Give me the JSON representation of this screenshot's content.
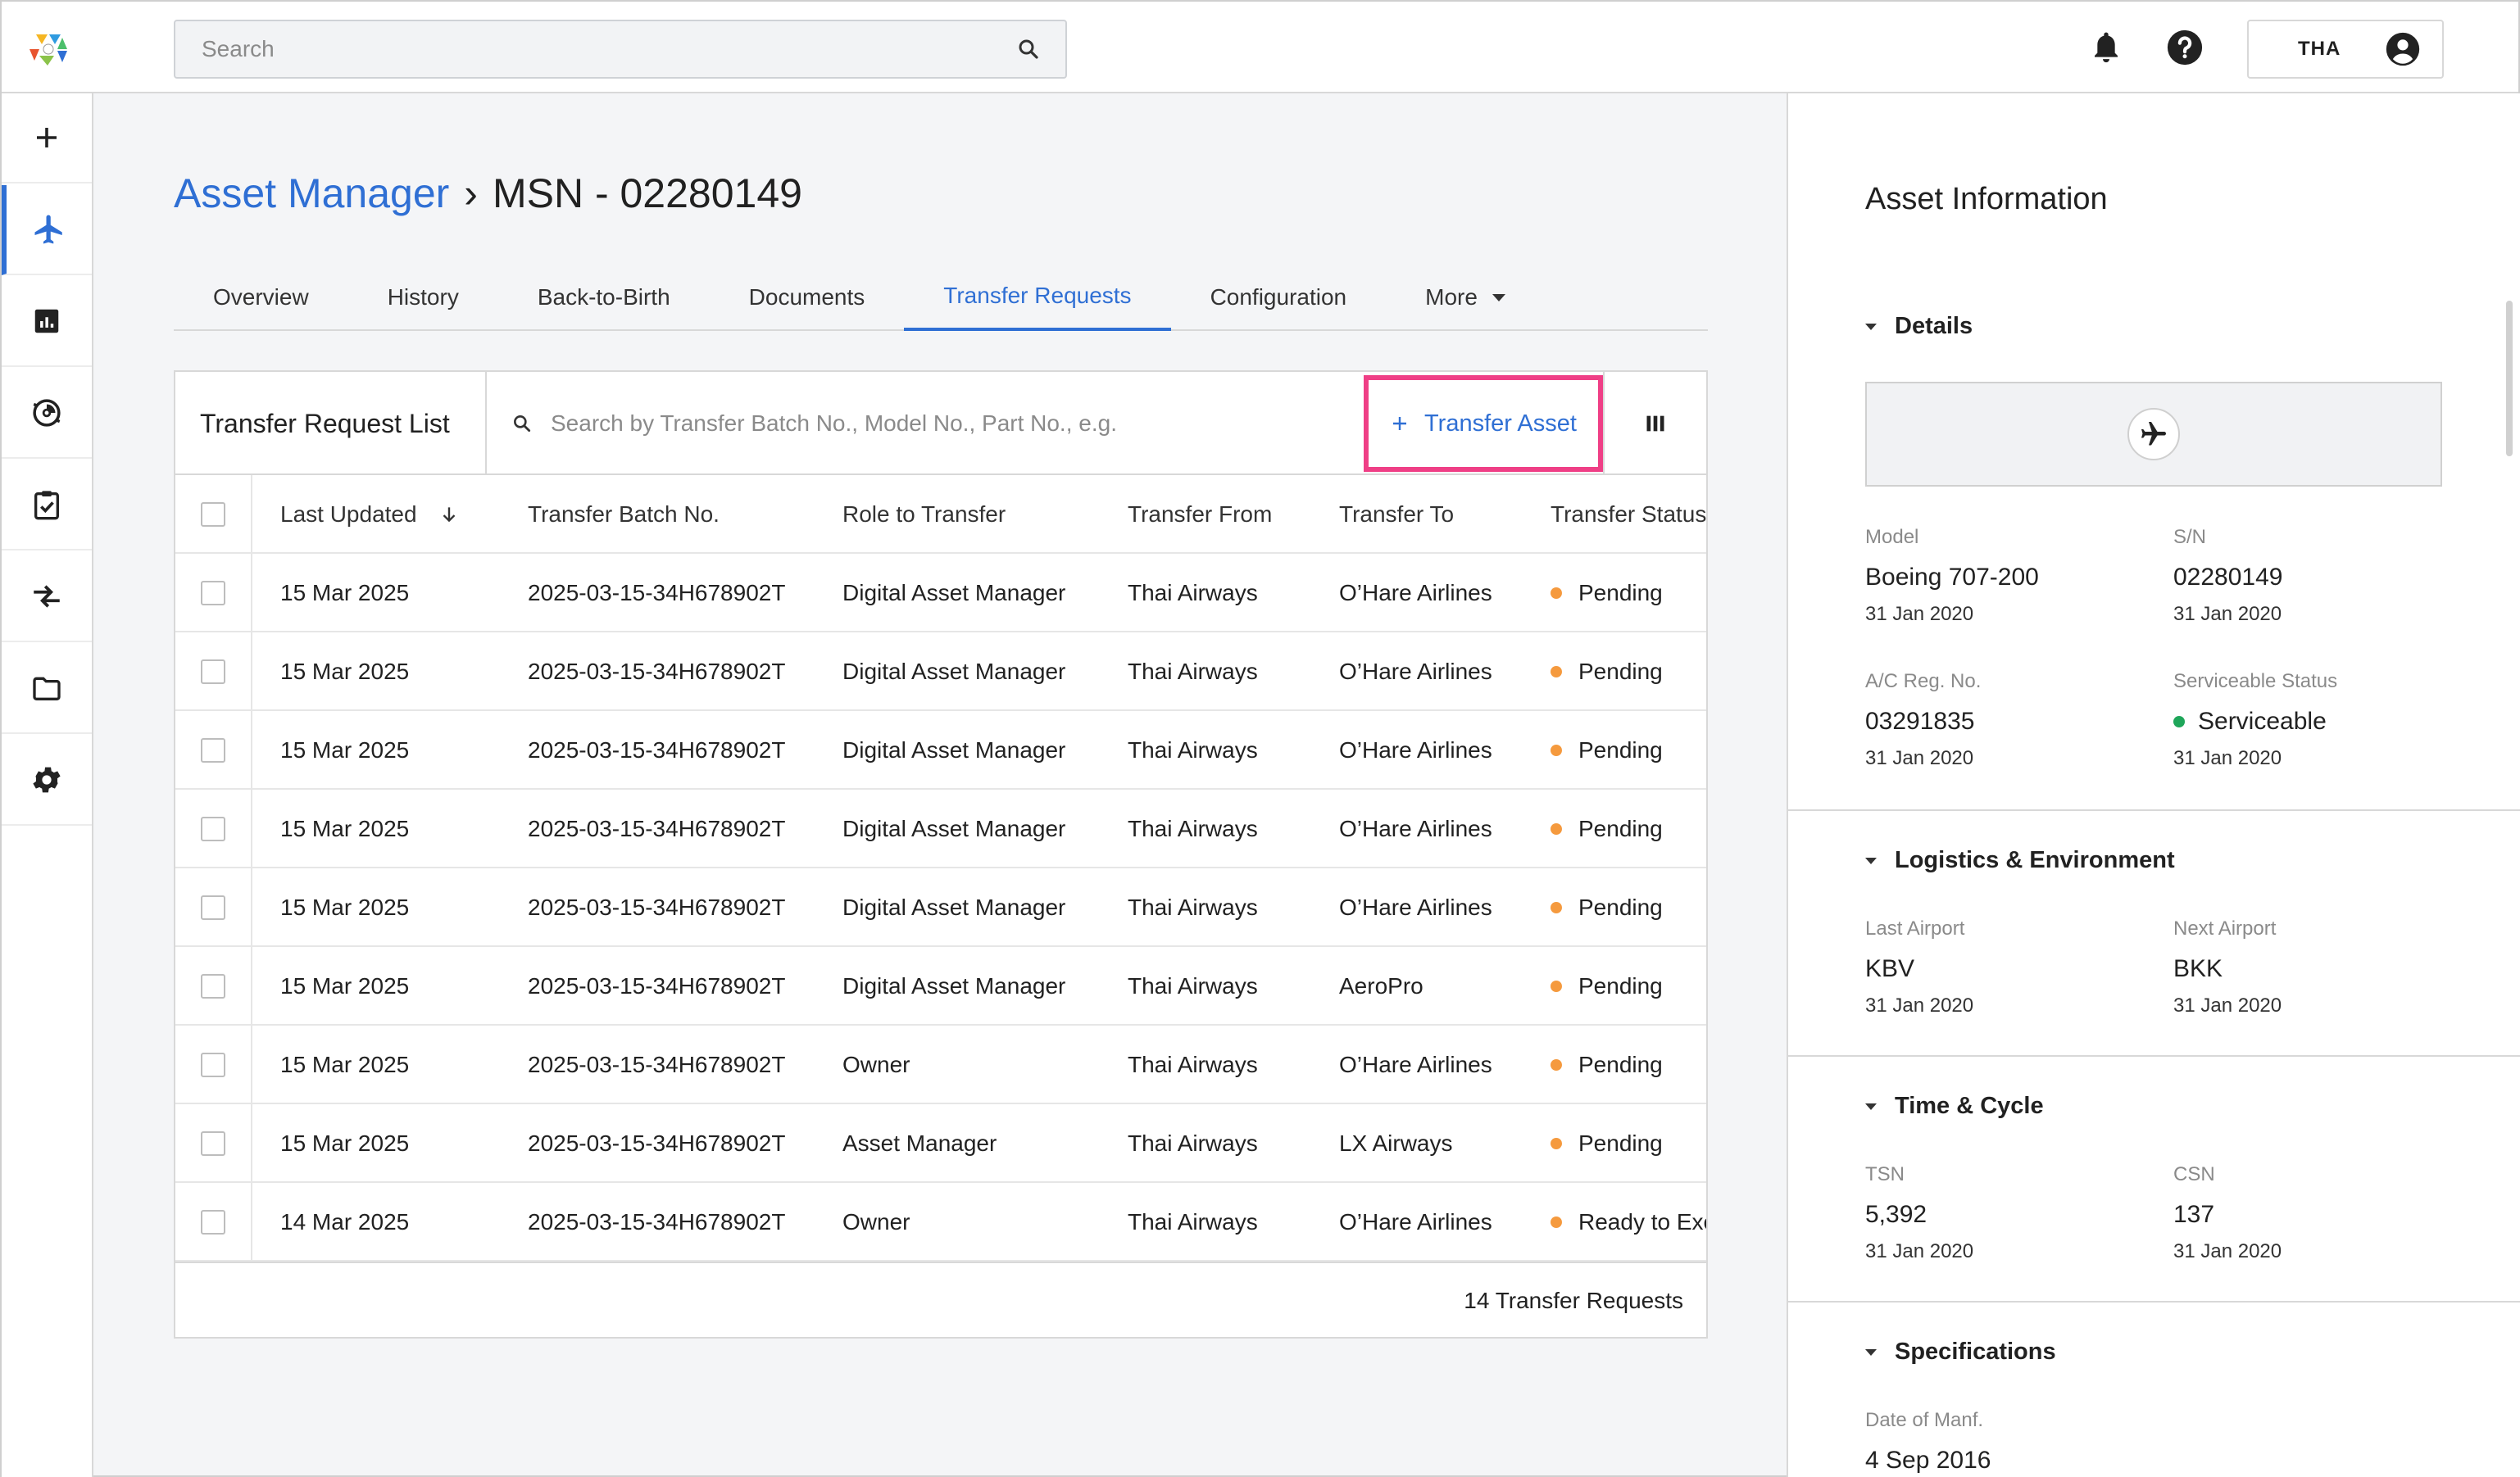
{
  "header": {
    "search_placeholder": "Search",
    "user_label": "THA"
  },
  "breadcrumb": {
    "root": "Asset Manager",
    "separator": "›",
    "current": "MSN - 02280149"
  },
  "tabs": [
    {
      "label": "Overview"
    },
    {
      "label": "History"
    },
    {
      "label": "Back-to-Birth"
    },
    {
      "label": "Documents"
    },
    {
      "label": "Transfer Requests"
    },
    {
      "label": "Configuration"
    },
    {
      "label": "More"
    }
  ],
  "list": {
    "title": "Transfer Request List",
    "search_placeholder": "Search by Transfer Batch No., Model No., Part No., e.g.",
    "add_button": "Transfer Asset",
    "columns": [
      "Last Updated",
      "Transfer Batch No.",
      "Role to Transfer",
      "Transfer From",
      "Transfer To",
      "Transfer Status"
    ],
    "rows": [
      {
        "updated": "15 Mar 2025",
        "batch": "2025-03-15-34H678902T",
        "role": "Digital Asset Manager",
        "from": "Thai Airways",
        "to": "O’Hare Airlines",
        "status": "Pending"
      },
      {
        "updated": "15 Mar 2025",
        "batch": "2025-03-15-34H678902T",
        "role": "Digital Asset Manager",
        "from": "Thai Airways",
        "to": "O’Hare Airlines",
        "status": "Pending"
      },
      {
        "updated": "15 Mar 2025",
        "batch": "2025-03-15-34H678902T",
        "role": "Digital Asset Manager",
        "from": "Thai Airways",
        "to": "O’Hare Airlines",
        "status": "Pending"
      },
      {
        "updated": "15 Mar 2025",
        "batch": "2025-03-15-34H678902T",
        "role": "Digital Asset Manager",
        "from": "Thai Airways",
        "to": "O’Hare Airlines",
        "status": "Pending"
      },
      {
        "updated": "15 Mar 2025",
        "batch": "2025-03-15-34H678902T",
        "role": "Digital Asset Manager",
        "from": "Thai Airways",
        "to": "O’Hare Airlines",
        "status": "Pending"
      },
      {
        "updated": "15 Mar 2025",
        "batch": "2025-03-15-34H678902T",
        "role": "Digital Asset Manager",
        "from": "Thai Airways",
        "to": "AeroPro",
        "status": "Pending"
      },
      {
        "updated": "15 Mar 2025",
        "batch": "2025-03-15-34H678902T",
        "role": "Owner",
        "from": "Thai Airways",
        "to": "O’Hare Airlines",
        "status": "Pending"
      },
      {
        "updated": "15 Mar 2025",
        "batch": "2025-03-15-34H678902T",
        "role": "Asset Manager",
        "from": "Thai Airways",
        "to": "LX Airways",
        "status": "Pending"
      },
      {
        "updated": "14 Mar 2025",
        "batch": "2025-03-15-34H678902T",
        "role": "Owner",
        "from": "Thai Airways",
        "to": "O’Hare Airlines",
        "status": "Ready to Execute"
      }
    ],
    "footer": "14 Transfer Requests"
  },
  "asset_info": {
    "title": "Asset Information",
    "details": {
      "heading": "Details",
      "model_label": "Model",
      "model_value": "Boeing 707-200",
      "model_date": "31 Jan 2020",
      "sn_label": "S/N",
      "sn_value": "02280149",
      "sn_date": "31 Jan 2020",
      "reg_label": "A/C Reg. No.",
      "reg_value": "03291835",
      "reg_date": "31 Jan 2020",
      "status_label": "Serviceable Status",
      "status_value": "Serviceable",
      "status_date": "31 Jan 2020"
    },
    "logistics": {
      "heading": "Logistics & Environment",
      "last_label": "Last Airport",
      "last_value": "KBV",
      "last_date": "31 Jan 2020",
      "next_label": "Next Airport",
      "next_value": "BKK",
      "next_date": "31 Jan 2020"
    },
    "time_cycle": {
      "heading": "Time & Cycle",
      "tsn_label": "TSN",
      "tsn_value": "5,392",
      "tsn_date": "31 Jan 2020",
      "csn_label": "CSN",
      "csn_value": "137",
      "csn_date": "31 Jan 2020"
    },
    "specs": {
      "heading": "Specifications",
      "manf_label": "Date of Manf.",
      "manf_value": "4 Sep 2016"
    }
  },
  "colors": {
    "accent": "#2f6fd4",
    "pending": "#f59a3e",
    "serviceable": "#1fa65a",
    "highlight": "#ef3f86"
  }
}
